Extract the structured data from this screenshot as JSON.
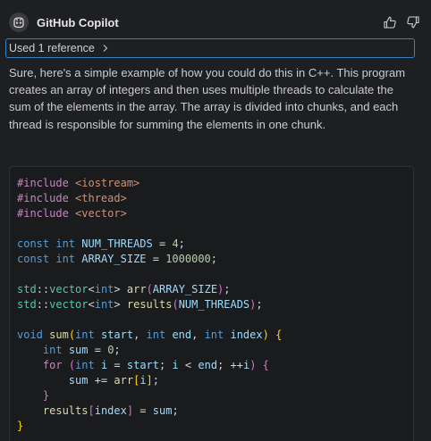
{
  "header": {
    "title": "GitHub Copilot",
    "avatar_icon": "copilot-icon",
    "thumbs_up_icon": "thumbs-up-icon",
    "thumbs_down_icon": "thumbs-down-icon"
  },
  "references": {
    "label": "Used 1 reference",
    "chevron_icon": "chevron-right-icon"
  },
  "message": {
    "text": "Sure, here's a simple example of how you could do this in C++. This program creates an array of integers and then uses multiple threads to calculate the sum of the elements in the array. The array is divided into chunks, and each thread is responsible for summing the elements in one chunk."
  },
  "code": {
    "language": "C++",
    "lines": [
      [
        [
          "#include ",
          "ctl"
        ],
        [
          "<iostream>",
          "str"
        ]
      ],
      [
        [
          "#include ",
          "ctl"
        ],
        [
          "<thread>",
          "str"
        ]
      ],
      [
        [
          "#include ",
          "ctl"
        ],
        [
          "<vector>",
          "str"
        ]
      ],
      [],
      [
        [
          "const ",
          "kw"
        ],
        [
          "int ",
          "kw"
        ],
        [
          "NUM_THREADS",
          "var"
        ],
        [
          " = ",
          "pl"
        ],
        [
          "4",
          "num"
        ],
        [
          ";",
          "pl"
        ]
      ],
      [
        [
          "const ",
          "kw"
        ],
        [
          "int ",
          "kw"
        ],
        [
          "ARRAY_SIZE",
          "var"
        ],
        [
          " = ",
          "pl"
        ],
        [
          "1000000",
          "num"
        ],
        [
          ";",
          "pl"
        ]
      ],
      [],
      [
        [
          "std",
          "ty"
        ],
        [
          "::",
          "pl"
        ],
        [
          "vector",
          "ty"
        ],
        [
          "<",
          "pl"
        ],
        [
          "int",
          "kw"
        ],
        [
          "> ",
          "pl"
        ],
        [
          "arr",
          "fn"
        ],
        [
          "(",
          "br2"
        ],
        [
          "ARRAY_SIZE",
          "var"
        ],
        [
          ")",
          "br2"
        ],
        [
          ";",
          "pl"
        ]
      ],
      [
        [
          "std",
          "ty"
        ],
        [
          "::",
          "pl"
        ],
        [
          "vector",
          "ty"
        ],
        [
          "<",
          "pl"
        ],
        [
          "int",
          "kw"
        ],
        [
          "> ",
          "pl"
        ],
        [
          "results",
          "fn"
        ],
        [
          "(",
          "br2"
        ],
        [
          "NUM_THREADS",
          "var"
        ],
        [
          ")",
          "br2"
        ],
        [
          ";",
          "pl"
        ]
      ],
      [],
      [
        [
          "void ",
          "kw"
        ],
        [
          "sum",
          "fn"
        ],
        [
          "(",
          "br1"
        ],
        [
          "int ",
          "kw"
        ],
        [
          "start",
          "var"
        ],
        [
          ", ",
          "pl"
        ],
        [
          "int ",
          "kw"
        ],
        [
          "end",
          "var"
        ],
        [
          ", ",
          "pl"
        ],
        [
          "int ",
          "kw"
        ],
        [
          "index",
          "var"
        ],
        [
          ")",
          "br1"
        ],
        [
          " ",
          "pl"
        ],
        [
          "{",
          "br1"
        ]
      ],
      [
        [
          "    ",
          "pl"
        ],
        [
          "int ",
          "kw"
        ],
        [
          "sum",
          "var"
        ],
        [
          " = ",
          "pl"
        ],
        [
          "0",
          "num"
        ],
        [
          ";",
          "pl"
        ]
      ],
      [
        [
          "    ",
          "pl"
        ],
        [
          "for ",
          "ctl"
        ],
        [
          "(",
          "br2"
        ],
        [
          "int ",
          "kw"
        ],
        [
          "i",
          "var"
        ],
        [
          " = ",
          "pl"
        ],
        [
          "start",
          "var"
        ],
        [
          "; ",
          "pl"
        ],
        [
          "i",
          "var"
        ],
        [
          " < ",
          "pl"
        ],
        [
          "end",
          "var"
        ],
        [
          "; ",
          "pl"
        ],
        [
          "++",
          "pl"
        ],
        [
          "i",
          "var"
        ],
        [
          ")",
          "br2"
        ],
        [
          " ",
          "pl"
        ],
        [
          "{",
          "br2"
        ]
      ],
      [
        [
          "        ",
          "pl"
        ],
        [
          "sum",
          "var"
        ],
        [
          " += ",
          "pl"
        ],
        [
          "arr",
          "fn"
        ],
        [
          "[",
          "br1"
        ],
        [
          "i",
          "var"
        ],
        [
          "]",
          "br1"
        ],
        [
          ";",
          "pl"
        ]
      ],
      [
        [
          "    ",
          "pl"
        ],
        [
          "}",
          "br2"
        ]
      ],
      [
        [
          "    ",
          "pl"
        ],
        [
          "results",
          "fn"
        ],
        [
          "[",
          "br2"
        ],
        [
          "index",
          "var"
        ],
        [
          "]",
          "br2"
        ],
        [
          " = ",
          "pl"
        ],
        [
          "sum",
          "var"
        ],
        [
          ";",
          "pl"
        ]
      ],
      [
        [
          "}",
          "br1"
        ]
      ]
    ]
  }
}
